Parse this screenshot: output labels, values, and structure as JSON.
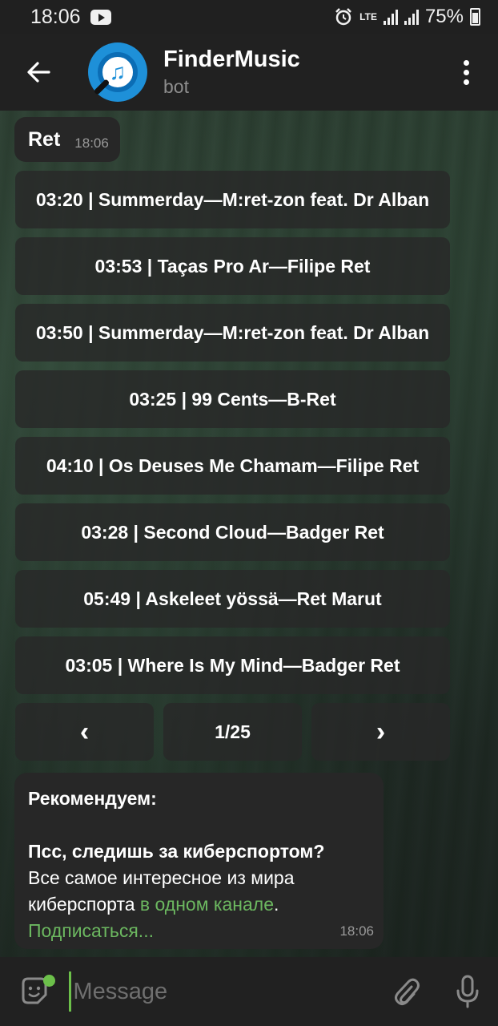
{
  "status_bar": {
    "time": "18:06",
    "network": "LTE",
    "battery": "75%",
    "icons": [
      "youtube-icon",
      "alarm-icon",
      "signal-icon",
      "battery-icon"
    ]
  },
  "header": {
    "title": "FinderMusic",
    "subtitle": "bot"
  },
  "query": {
    "text": "Ret",
    "time": "18:06"
  },
  "tracks": [
    "03:20 | Summerday—M:ret-zon feat. Dr Alban",
    "03:53 | Taças Pro Ar—Filipe Ret",
    "03:50 | Summerday—M:ret-zon feat. Dr Alban",
    "03:25 | 99 Cents—B-Ret",
    "04:10 | Os Deuses Me Chamam—Filipe Ret",
    "03:28 | Second Cloud—Badger Ret",
    "05:49 | Askeleet yössä—Ret Marut",
    "03:05 | Where Is My Mind—Badger Ret"
  ],
  "pagination": {
    "prev": "‹",
    "page": "1/25",
    "next": "›"
  },
  "promo": {
    "heading": "Рекомендуем:",
    "question": "Псс, следишь за киберспортом?",
    "text_before": "Все самое интересное из мира киберспорта ",
    "link_text": "в одном канале",
    "text_after": ".",
    "subscribe": "Подписаться...",
    "time": "18:06"
  },
  "input": {
    "placeholder": "Message"
  },
  "colors": {
    "accent_green": "#6cb860",
    "header_bg": "#212121",
    "bubble_bg": "#272727",
    "avatar_blue": "#1e90d8"
  }
}
